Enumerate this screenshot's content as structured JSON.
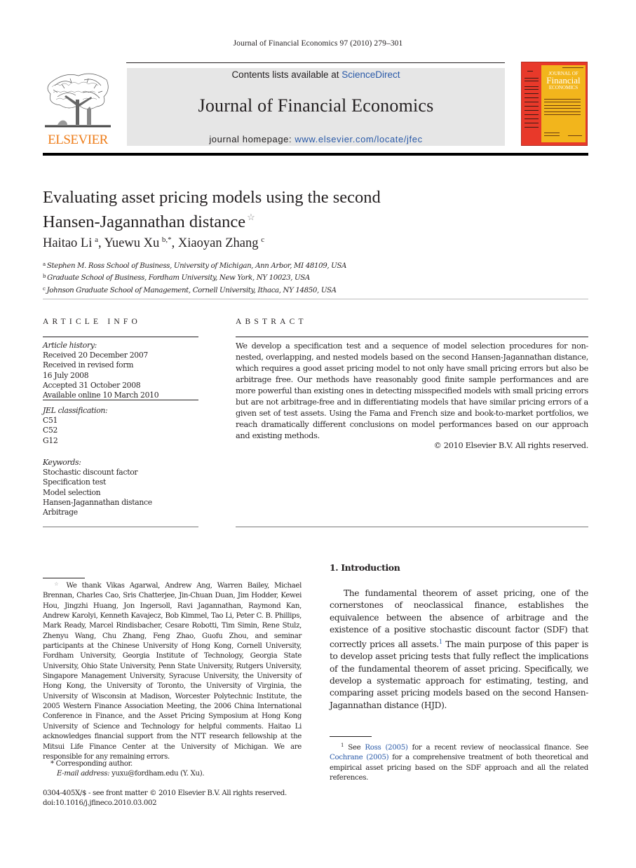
{
  "running_header": "Journal of Financial Economics 97 (2010) 279–301",
  "masthead": {
    "contents_prefix": "Contents lists available at ",
    "contents_link": "ScienceDirect",
    "journal_title": "Journal of Financial Economics",
    "homepage_prefix": "journal homepage: ",
    "homepage_link": "www.elsevier.com/locate/jfec",
    "publisher_logo_text": "ELSEVIER",
    "cover": {
      "line1": "JOURNAL OF",
      "line2": "Financial",
      "line3": "ECONOMICS"
    },
    "colors": {
      "elsevier_orange": "#ee7d1a",
      "link_blue": "#2a5aa8",
      "cover_red": "#e8392a",
      "cover_yellow": "#f2b51c",
      "masthead_gray": "#e6e6e6"
    }
  },
  "article": {
    "title_line1": "Evaluating asset pricing models using the second",
    "title_line2": "Hansen-Jagannathan distance",
    "title_footnote_mark": "☆",
    "authors": [
      {
        "name": "Haitao Li",
        "sup": "a"
      },
      {
        "name": "Yuewu Xu",
        "sup": "b,*"
      },
      {
        "name": "Xiaoyan Zhang",
        "sup": "c"
      }
    ],
    "affiliations": [
      {
        "mark": "a",
        "text": "Stephen M. Ross School of Business, University of Michigan, Ann Arbor, MI 48109, USA"
      },
      {
        "mark": "b",
        "text": "Graduate School of Business, Fordham University, New York, NY 10023, USA"
      },
      {
        "mark": "c",
        "text": "Johnson Graduate School of Management, Cornell University, Ithaca, NY 14850, USA"
      }
    ]
  },
  "article_info": {
    "heading": "ARTICLE INFO",
    "history_label": "Article history:",
    "history": [
      "Received 20 December 2007",
      "Received in revised form",
      "16 July 2008",
      "Accepted 31 October 2008",
      "Available online 10 March 2010"
    ],
    "jel_label": "JEL classification:",
    "jel": [
      "C51",
      "C52",
      "G12"
    ],
    "keywords_label": "Keywords:",
    "keywords": [
      "Stochastic discount factor",
      "Specification test",
      "Model selection",
      "Hansen-Jagannathan distance",
      "Arbitrage"
    ]
  },
  "abstract": {
    "heading": "ABSTRACT",
    "text": "We develop a specification test and a sequence of model selection procedures for non-nested, overlapping, and nested models based on the second Hansen-Jagannathan distance, which requires a good asset pricing model to not only have small pricing errors but also be arbitrage free. Our methods have reasonably good finite sample performances and are more powerful than existing ones in detecting misspecified models with small pricing errors but are not arbitrage-free and in differentiating models that have similar pricing errors of a given set of test assets. Using the Fama and French size and book-to-market portfolios, we reach dramatically different conclusions on model performances based on our approach and existing methods.",
    "copyright": "© 2010 Elsevier B.V. All rights reserved."
  },
  "introduction": {
    "heading": "1.  Introduction",
    "para_part1": "The fundamental theorem of asset pricing, one of the cornerstones of neoclassical finance, establishes the equivalence between the absence of arbitrage and the existence of a positive stochastic discount factor (SDF) that correctly prices all assets.",
    "para_fnmark": "1",
    "para_part2": " The main purpose of this paper is to develop asset pricing tests that fully reflect the implications of the fundamental theorem of asset pricing. Specifically, we develop a systematic approach for estimating, testing, and comparing asset pricing models based on the second Hansen-Jagannathan distance (HJD).",
    "footnote": {
      "mark": "1",
      "prefix": " See ",
      "link1": "Ross (2005)",
      "middle": " for a recent review of neoclassical finance. See ",
      "link2": "Cochrane (2005)",
      "suffix": " for a comprehensive treatment of both theoretical and empirical asset pricing based on the SDF approach and all the related references."
    }
  },
  "front_footnotes": {
    "star_mark": "☆",
    "acknowledgment": " We thank Vikas Agarwal, Andrew Ang, Warren Bailey, Michael Brennan, Charles Cao, Sris Chatterjee, Jin-Chuan Duan, Jim Hodder, Kewei Hou, Jingzhi Huang, Jon Ingersoll, Ravi Jagannathan, Raymond Kan, Andrew Karolyi, Kenneth Kavajecz, Bob Kimmel, Tao Li, Peter C. B. Phillips, Mark Ready, Marcel Rindisbacher, Cesare Robotti, Tim Simin, Rene Stulz, Zhenyu Wang, Chu Zhang, Feng Zhao, Guofu Zhou, and seminar participants at the Chinese University of Hong Kong, Cornell University, Fordham University, Georgia Institute of Technology, Georgia State University, Ohio State University, Penn State University, Rutgers University, Singapore Management University, Syracuse University, the University of Hong Kong, the University of Toronto, the University of Virginia, the University of Wisconsin at Madison, Worcester Polytechnic Institute, the 2005 Western Finance Association Meeting, the 2006 China International Conference in Finance, and the Asset Pricing Symposium at Hong Kong University of Science and Technology for helpful comments. Haitao Li acknowledges financial support from the NTT research fellowship at the Mitsui Life Finance Center at the University of Michigan. We are responsible for any remaining errors.",
    "corresponding": "* Corresponding author.",
    "email_label": "E-mail address:",
    "email": " yuxu@fordham.edu (Y. Xu).",
    "issn": "0304-405X/$ - see front matter © 2010 Elsevier B.V. All rights reserved.",
    "doi": "doi:10.1016/j.jfineco.2010.03.002"
  }
}
